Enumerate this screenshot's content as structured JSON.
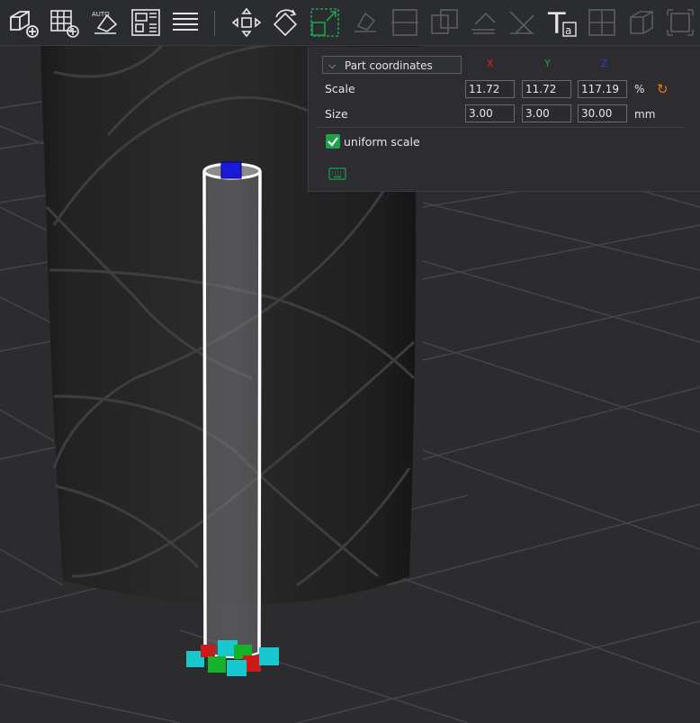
{
  "panel": {
    "coord_mode": "Part coordinates",
    "axis_x": "X",
    "axis_y": "Y",
    "axis_z": "Z",
    "scale_label": "Scale",
    "scale_x": "11.72",
    "scale_y": "11.72",
    "scale_z": "117.19",
    "scale_unit": "%",
    "size_label": "Size",
    "size_x": "3.00",
    "size_y": "3.00",
    "size_z": "30.00",
    "size_unit": "mm",
    "uniform_label": "uniform scale",
    "uniform_checked": true
  },
  "toolbar": {
    "icons": [
      "add-part-icon",
      "add-plate-icon",
      "auto-orient-icon",
      "arrange-icon",
      "layers-icon",
      "move-icon",
      "rotate-icon",
      "scale-icon",
      "lay-on-face-icon",
      "cut-icon",
      "boolean-icon",
      "support-paint-icon",
      "seam-paint-icon",
      "text-icon",
      "measure-icon",
      "assemble-icon"
    ],
    "text_tool": "T",
    "text_tool_sub": "a"
  },
  "colors": {
    "accent": "#1fa04a",
    "axis_x": "#e0241b",
    "axis_y": "#1faa2b",
    "axis_z": "#2b3fd6",
    "reset": "#e87a1a"
  }
}
